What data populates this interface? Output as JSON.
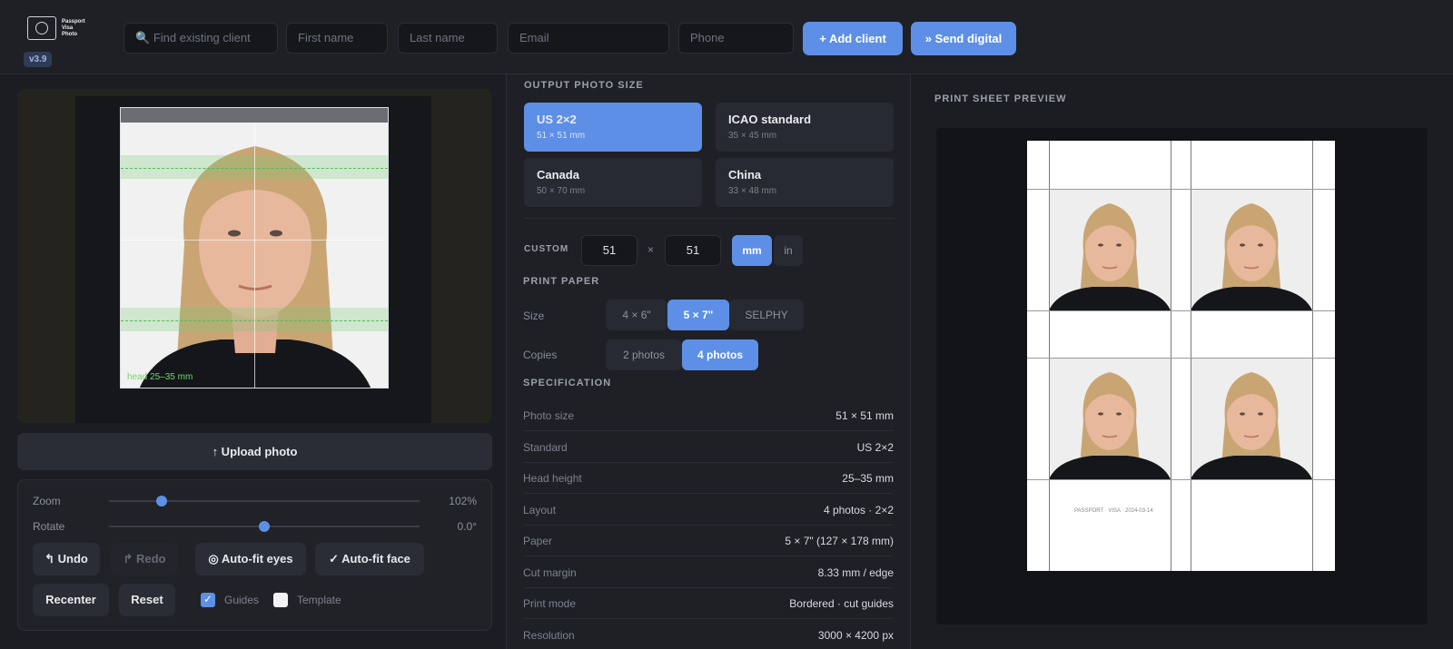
{
  "app": {
    "logo_text": [
      "Passport",
      "Visa",
      "Photo"
    ],
    "version": "v3.9"
  },
  "topbar": {
    "search_placeholder": "Find existing client",
    "first_name_placeholder": "First name",
    "last_name_placeholder": "Last name",
    "email_placeholder": "Email",
    "phone_placeholder": "Phone",
    "add_client_label": "+ Add client",
    "send_digital_label": "» Send digital"
  },
  "editor": {
    "head_label": "head 25–35 mm",
    "upload_label": "↑ Upload photo",
    "zoom": {
      "label": "Zoom",
      "value": "102%",
      "level": 0.17
    },
    "rotate": {
      "label": "Rotate",
      "value": "0.0°",
      "level": 0.5
    },
    "buttons": {
      "undo": "↰ Undo",
      "redo": "↱ Redo",
      "auto_fit_eyes": "◎ Auto-fit eyes",
      "auto_fit_face": "✓ Auto-fit face",
      "recenter": "Recenter",
      "reset": "Reset"
    },
    "guides": {
      "label": "Guides",
      "checked": true
    },
    "template": {
      "label": "Template",
      "checked": false
    }
  },
  "output": {
    "heading": "OUTPUT PHOTO SIZE",
    "sizes": [
      {
        "name": "US 2×2",
        "dims": "51 × 51 mm",
        "selected": true
      },
      {
        "name": "ICAO standard",
        "dims": "35 × 45 mm",
        "selected": false
      },
      {
        "name": "Canada",
        "dims": "50 × 70 mm",
        "selected": false
      },
      {
        "name": "China",
        "dims": "33 × 48 mm",
        "selected": false
      }
    ],
    "custom_label": "CUSTOM",
    "custom_w": "51",
    "custom_sep": "×",
    "custom_h": "51",
    "unit_mm": "mm",
    "unit_in": "in"
  },
  "paper": {
    "heading": "PRINT PAPER",
    "size_label": "Size",
    "sizes": [
      "4 × 6\"",
      "5 × 7\"",
      "SELPHY"
    ],
    "selected_size": "5 × 7\"",
    "copies_label": "Copies",
    "copies": [
      "2 photos",
      "4 photos"
    ],
    "selected_copies": "4 photos"
  },
  "spec": {
    "heading": "SPECIFICATION",
    "rows": [
      {
        "k": "Photo size",
        "v": "51 × 51 mm"
      },
      {
        "k": "Standard",
        "v": "US 2×2"
      },
      {
        "k": "Head height",
        "v": "25–35 mm"
      },
      {
        "k": "Layout",
        "v": "4 photos · 2×2"
      },
      {
        "k": "Paper",
        "v": "5 × 7\" (127 × 178 mm)"
      },
      {
        "k": "Cut margin",
        "v": "8.33 mm / edge"
      },
      {
        "k": "Print mode",
        "v": "Bordered · cut guides"
      },
      {
        "k": "Resolution",
        "v": "3000 × 4200 px"
      }
    ]
  },
  "print_preview": {
    "heading": "PRINT SHEET PREVIEW",
    "note": "PASSPORT · VISA · 2024-03-14"
  },
  "colors": {
    "accent": "#5d8fe6",
    "background": "#1b1d22",
    "panel": "#1e2026",
    "guide_green": "#55b85a"
  }
}
